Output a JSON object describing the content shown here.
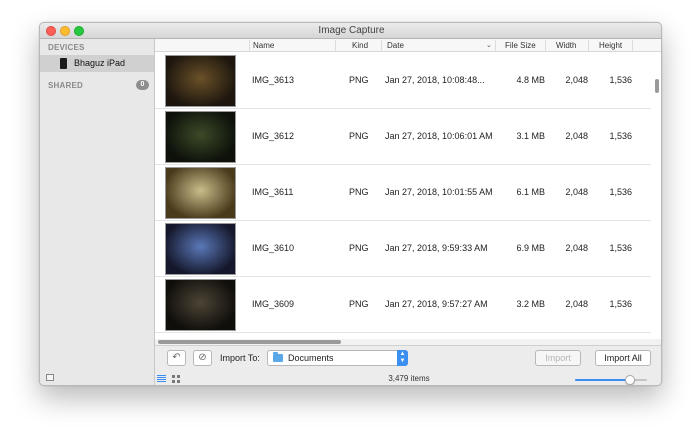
{
  "window": {
    "title": "Image Capture"
  },
  "sidebar": {
    "devices_header": "DEVICES",
    "device_label": "Bhaguz iPad",
    "shared_header": "SHARED",
    "shared_count": "0"
  },
  "columns": {
    "name": "Name",
    "kind": "Kind",
    "date": "Date",
    "file_size": "File Size",
    "width": "Width",
    "height": "Height"
  },
  "rows": [
    {
      "name": "IMG_3613",
      "kind": "PNG",
      "date": "Jan 27, 2018, 10:08:48...",
      "size": "4.8 MB",
      "width": "2,048",
      "height": "1,536",
      "thumb_colors": [
        "#6a5128",
        "#1d160e"
      ]
    },
    {
      "name": "IMG_3612",
      "kind": "PNG",
      "date": "Jan 27, 2018, 10:06:01 AM",
      "size": "3.1 MB",
      "width": "2,048",
      "height": "1,536",
      "thumb_colors": [
        "#3c4a28",
        "#0d110a"
      ]
    },
    {
      "name": "IMG_3611",
      "kind": "PNG",
      "date": "Jan 27, 2018, 10:01:55 AM",
      "size": "6.1 MB",
      "width": "2,048",
      "height": "1,536",
      "thumb_colors": [
        "#c9bd8a",
        "#4a3a1c"
      ]
    },
    {
      "name": "IMG_3610",
      "kind": "PNG",
      "date": "Jan 27, 2018, 9:59:33 AM",
      "size": "6.9 MB",
      "width": "2,048",
      "height": "1,536",
      "thumb_colors": [
        "#5a78b8",
        "#15182c"
      ]
    },
    {
      "name": "IMG_3609",
      "kind": "PNG",
      "date": "Jan 27, 2018, 9:57:27 AM",
      "size": "3.2 MB",
      "width": "2,048",
      "height": "1,536",
      "thumb_colors": [
        "#4d4536",
        "#100e0b"
      ]
    }
  ],
  "import_bar": {
    "rotate_icon": "rotate-left-icon",
    "delete_icon": "no-entry-icon",
    "import_to_label": "Import To:",
    "destination": "Documents",
    "import_label": "Import",
    "import_all_label": "Import All"
  },
  "status": {
    "item_count": "3,479 items",
    "thumbnail_size": 0.77
  },
  "colors": {
    "accent": "#3b8ef0",
    "close": "#fc5f57",
    "minimize": "#fdbc2e",
    "zoom": "#28c840"
  }
}
